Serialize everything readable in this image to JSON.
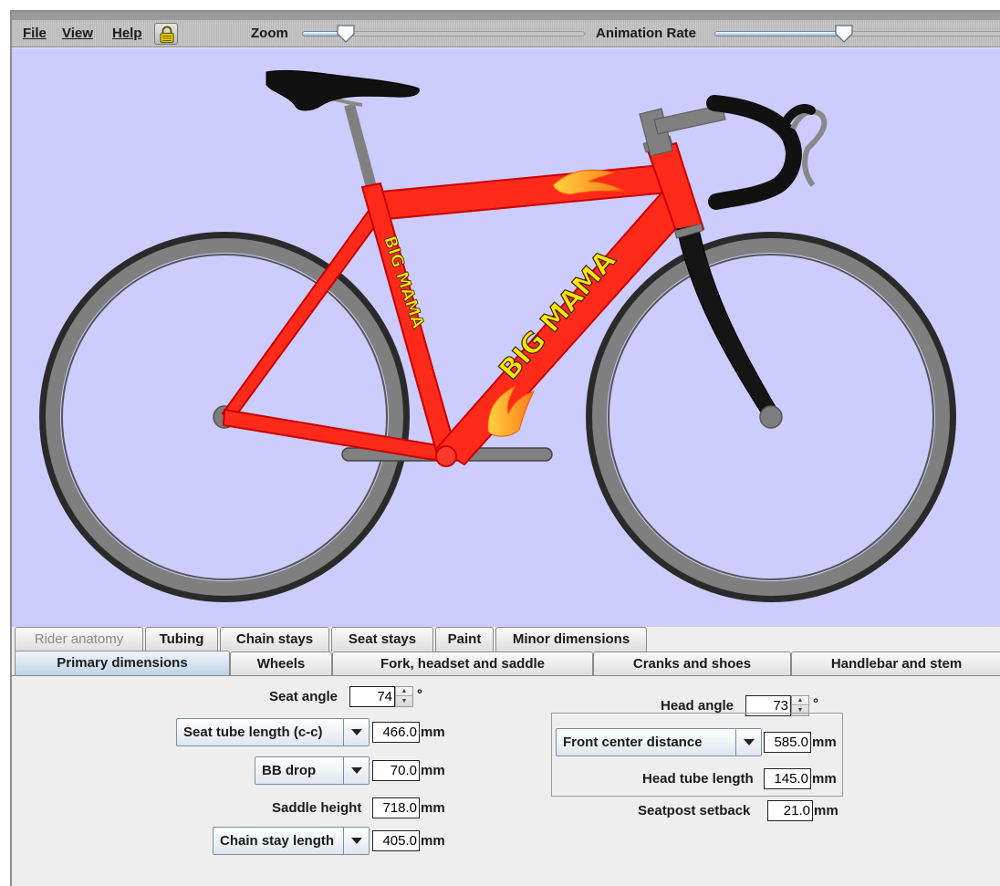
{
  "menubar": {
    "file": "File",
    "view": "View",
    "help": "Help",
    "lock_icon": "padlock-icon",
    "zoom_label": "Zoom",
    "zoom_level": 0.16,
    "animation_rate_label": "Animation Rate",
    "animation_rate_level": 0.45
  },
  "bike": {
    "downtube_text": "BIG MAMA",
    "seattube_text": "BIG MAMA",
    "frame_color": "#ff2a1a",
    "flame_color": "#ffc12e"
  },
  "tabs": {
    "row1": [
      "Rider anatomy",
      "Tubing",
      "Chain stays",
      "Seat stays",
      "Paint",
      "Minor dimensions"
    ],
    "row2": [
      "Primary dimensions",
      "Wheels",
      "Fork, headset and saddle",
      "Cranks and shoes",
      "Handlebar and stem"
    ],
    "selected": "Primary dimensions",
    "disabled": "Rider anatomy"
  },
  "form": {
    "seat_angle": {
      "label": "Seat angle",
      "value": "74",
      "unit": "°"
    },
    "seat_tube": {
      "combo": "Seat tube length (c-c)",
      "value": "466.0",
      "unit": "mm"
    },
    "bb": {
      "combo": "BB drop",
      "value": "70.0",
      "unit": "mm"
    },
    "saddle_height": {
      "label": "Saddle height",
      "value": "718.0",
      "unit": "mm"
    },
    "chain_stay": {
      "combo": "Chain stay length",
      "value": "405.0",
      "unit": "mm"
    },
    "head_angle": {
      "label": "Head angle",
      "value": "73",
      "unit": "°"
    },
    "front_center": {
      "combo": "Front center distance",
      "value": "585.0",
      "unit": "mm"
    },
    "head_tube": {
      "label": "Head tube length",
      "value": "145.0",
      "unit": "mm"
    },
    "seatpost_setback": {
      "label": "Seatpost setback",
      "value": "21.0",
      "unit": "mm"
    }
  }
}
